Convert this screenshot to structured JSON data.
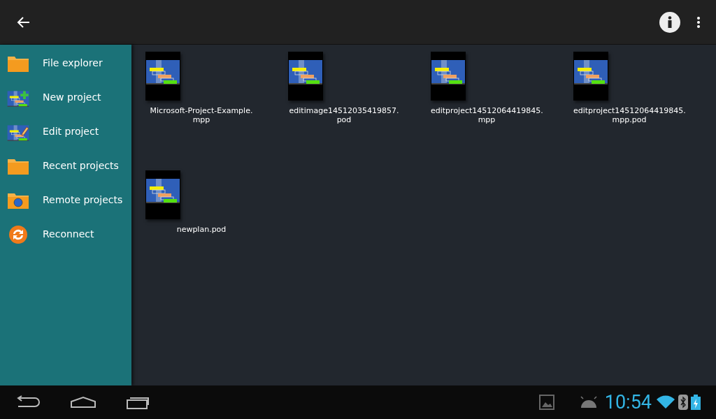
{
  "sidebar": {
    "items": [
      {
        "label": "File explorer",
        "kind": "folder"
      },
      {
        "label": "New project",
        "kind": "new"
      },
      {
        "label": "Edit project",
        "kind": "edit"
      },
      {
        "label": "Recent projects",
        "kind": "folder"
      },
      {
        "label": "Remote projects",
        "kind": "remote"
      },
      {
        "label": "Reconnect",
        "kind": "reconnect"
      }
    ]
  },
  "files": [
    {
      "name_lines": [
        "Microsoft-Project-Example.",
        "mpp"
      ]
    },
    {
      "name_lines": [
        "editimage14512035419857.",
        "pod"
      ]
    },
    {
      "name_lines": [
        "editproject14512064419845.",
        "mpp"
      ]
    },
    {
      "name_lines": [
        "editproject14512064419845.",
        "mpp.pod"
      ]
    },
    {
      "name_lines": [
        "newplan.pod"
      ]
    }
  ],
  "status_bar": {
    "time": "10:54"
  }
}
